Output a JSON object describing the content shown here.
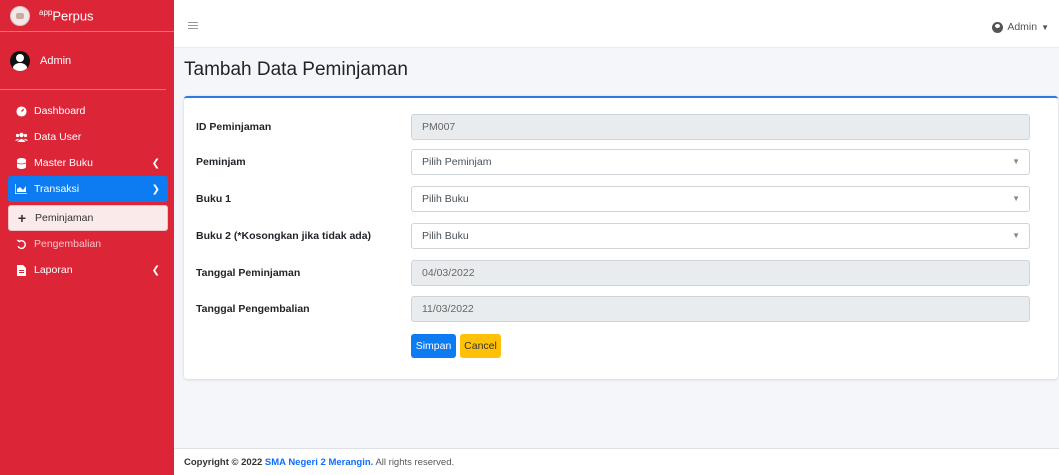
{
  "brand": {
    "prefix": "app",
    "name": "Perpus"
  },
  "user_panel": {
    "name": "Admin"
  },
  "sidebar": {
    "items": [
      {
        "label": "Dashboard",
        "icon": "dashboard-icon"
      },
      {
        "label": "Data User",
        "icon": "users-icon"
      },
      {
        "label": "Master Buku",
        "icon": "database-icon"
      },
      {
        "label": "Transaksi",
        "icon": "chart-icon"
      },
      {
        "label": "Peminjaman",
        "icon": "plus-icon"
      },
      {
        "label": "Pengembalian",
        "icon": "undo-icon"
      },
      {
        "label": "Laporan",
        "icon": "file-icon"
      }
    ]
  },
  "topbar": {
    "user_label": "Admin"
  },
  "page": {
    "title": "Tambah Data Peminjaman"
  },
  "form": {
    "id_label": "ID Peminjaman",
    "id_value": "PM007",
    "peminjam_label": "Peminjam",
    "peminjam_value": "Pilih Peminjam",
    "buku1_label": "Buku 1",
    "buku1_value": "Pilih Buku",
    "buku2_label": "Buku 2 (*Kosongkan jika tidak ada)",
    "buku2_value": "Pilih Buku",
    "tgl_pinjam_label": "Tanggal Peminjaman",
    "tgl_pinjam_value": "04/03/2022",
    "tgl_kembali_label": "Tanggal Pengembalian",
    "tgl_kembali_value": "11/03/2022",
    "save_label": "Simpan",
    "cancel_label": "Cancel"
  },
  "footer": {
    "prefix": "Copyright © 2022",
    "link": "SMA Negeri 2 Merangin.",
    "suffix": "All rights reserved."
  },
  "colors": {
    "sidebar": "#dc2638",
    "primary": "#0d7cf2",
    "warning": "#ffc107",
    "background": "#f4f6f9"
  }
}
